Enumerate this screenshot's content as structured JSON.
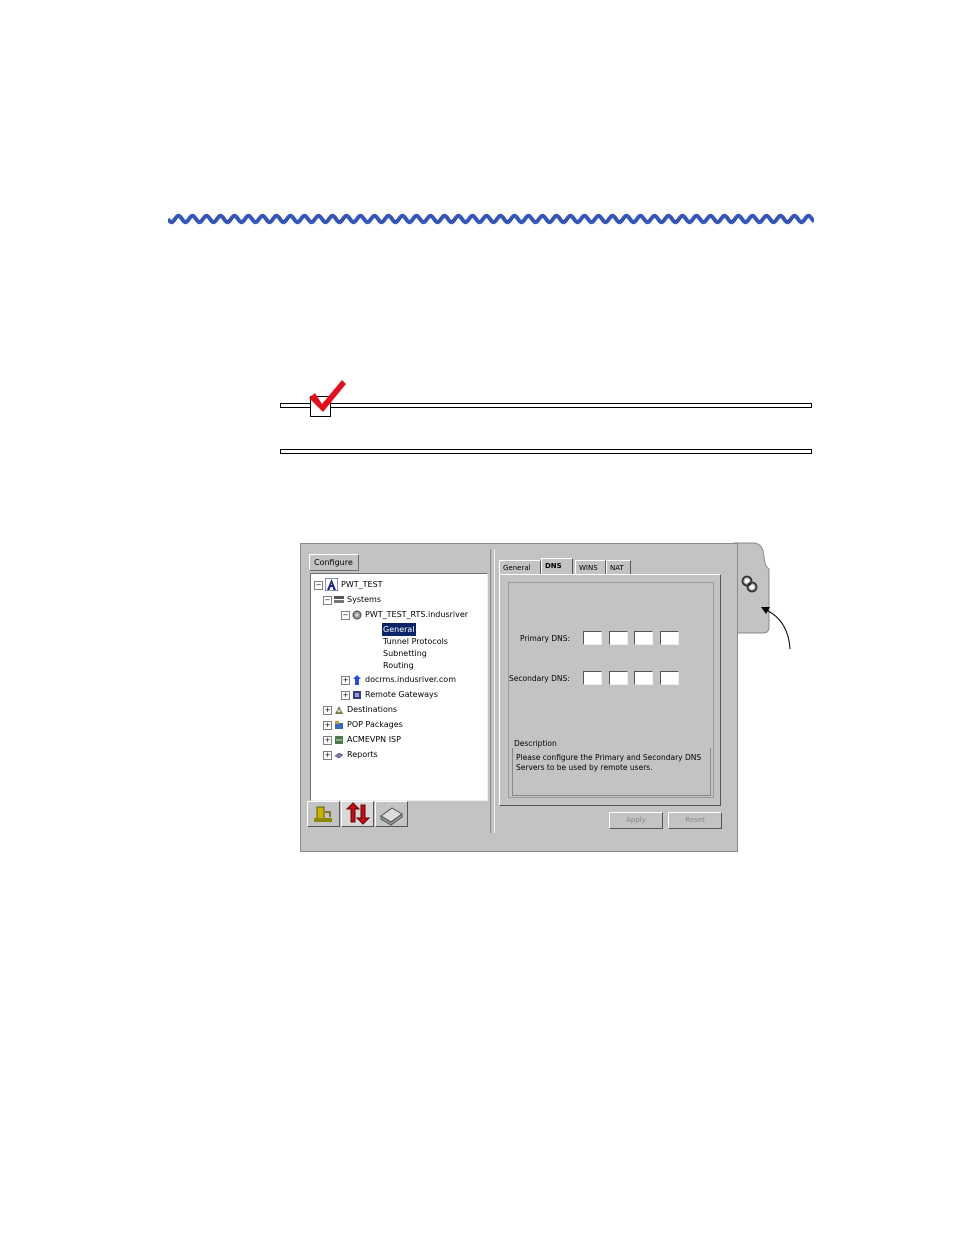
{
  "window": {
    "configure_label": "Configure ▾",
    "tree": [
      {
        "label": "PWT_TEST",
        "icon": "logo-a-icon",
        "level": 0,
        "expander": "−"
      },
      {
        "label": "Systems",
        "icon": "systems-icon",
        "level": 1,
        "expander": "−"
      },
      {
        "label": "PWT_TEST_RTS.indusriver",
        "icon": "server-icon",
        "level": 2,
        "expander": "−"
      },
      {
        "label": "General",
        "icon": "",
        "level": 3,
        "expander": "",
        "selected": true
      },
      {
        "label": "Tunnel Protocols",
        "icon": "",
        "level": 3,
        "expander": ""
      },
      {
        "label": "Subnetting",
        "icon": "",
        "level": 3,
        "expander": ""
      },
      {
        "label": "Routing",
        "icon": "",
        "level": 3,
        "expander": ""
      },
      {
        "label": "docrms.indusriver.com",
        "icon": "host-icon",
        "level": 2,
        "expander": "+"
      },
      {
        "label": "Remote Gateways",
        "icon": "gateway-icon",
        "level": 2,
        "expander": "+"
      },
      {
        "label": "Destinations",
        "icon": "destinations-icon",
        "level": 1,
        "expander": "+"
      },
      {
        "label": "POP Packages",
        "icon": "package-icon",
        "level": 1,
        "expander": "+"
      },
      {
        "label": "ACMEVPN ISP",
        "icon": "isp-icon",
        "level": 1,
        "expander": "+"
      },
      {
        "label": "Reports",
        "icon": "reports-icon",
        "level": 1,
        "expander": "+"
      }
    ],
    "tabs": [
      "General",
      "DNS",
      "WINS",
      "NAT"
    ],
    "active_tab": "DNS",
    "primary_dns_label": "Primary DNS:",
    "secondary_dns_label": "Secondary DNS:",
    "description_title": "Description",
    "description_text": "Please configure the Primary and Secondary DNS Servers to be used by remote users.",
    "apply_label": "Apply",
    "reset_label": "Reset"
  },
  "colors": {
    "wave": "#3556b8",
    "check": "#e0101e",
    "selection": "#0a246a",
    "panel": "#c3c3c3"
  }
}
